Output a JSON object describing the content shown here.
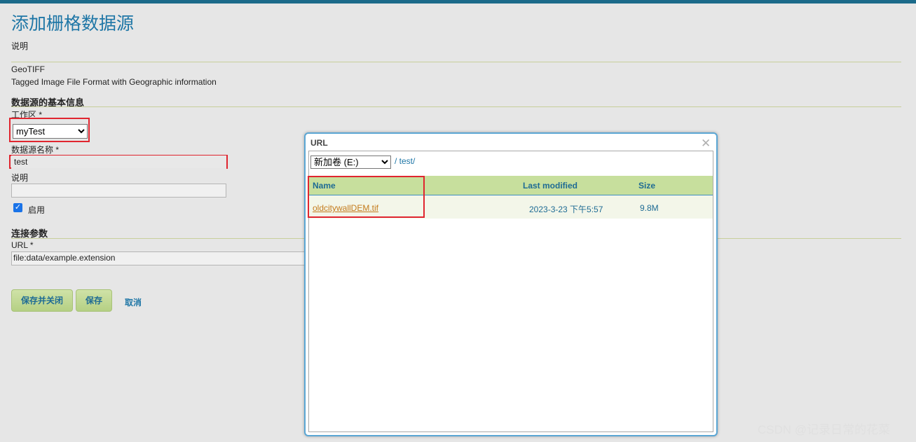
{
  "page": {
    "title": "添加栅格数据源",
    "description_label": "说明",
    "format_name": "GeoTIFF",
    "format_desc": "Tagged Image File Format with Geographic information",
    "basic_section": "数据源的基本信息",
    "workspace_label": "工作区 *",
    "workspace_value": "myTest",
    "name_label": "数据源名称 *",
    "name_value": "test",
    "desc_field_label": "说明",
    "desc_value": "",
    "enabled_label": "启用",
    "conn_section": "连接参数",
    "url_label": "URL *",
    "url_value": "file:data/example.extension",
    "save_close_label": "保存并关闭",
    "save_label": "保存",
    "cancel_label": "取消"
  },
  "dialog": {
    "title": "URL",
    "drive": "新加卷 (E:)",
    "path": "/ test/",
    "columns": {
      "name": "Name",
      "modified": "Last modified",
      "size": "Size"
    },
    "files": [
      {
        "name": "oldcitywallDEM.tif",
        "modified": "2023-3-23 下午5:57",
        "size": "9.8M"
      }
    ]
  },
  "watermark": "CSDN @记录日常的花菜",
  "colors": {
    "accent": "#1e76a6",
    "highlight": "#e0252f",
    "header_bg": "#c7df9d"
  }
}
